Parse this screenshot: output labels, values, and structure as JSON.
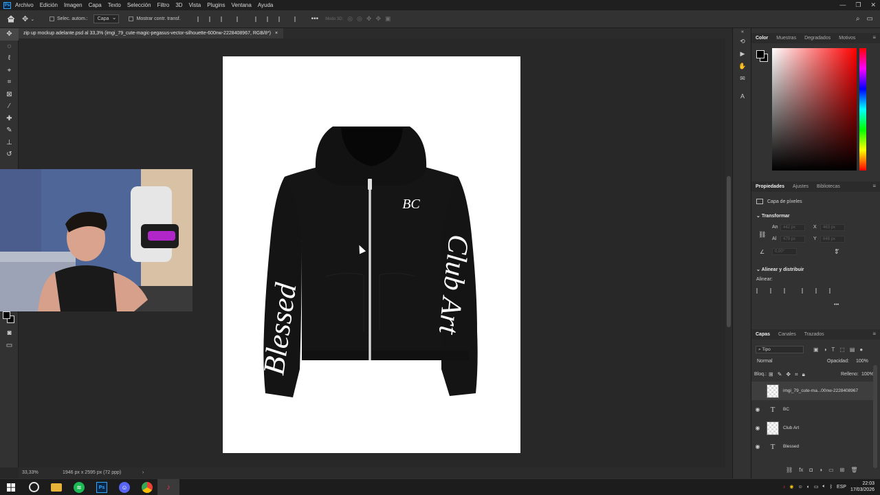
{
  "app": {
    "menu": [
      "Archivo",
      "Edición",
      "Imagen",
      "Capa",
      "Texto",
      "Selección",
      "Filtro",
      "3D",
      "Vista",
      "Plugins",
      "Ventana",
      "Ayuda"
    ]
  },
  "options_bar": {
    "auto_select_label": "Selec. autom.:",
    "auto_select_value": "Capa",
    "show_transform_label": "Mostrar contr. transf.",
    "mode_3d_label": "Modo 3D:"
  },
  "document": {
    "tab_title": "zip up mockup adelante.psd al 33,3% (imgi_79_cute-magic-pegasus-vector-silhouette-600nw-2228408967, RGB/8*)",
    "close_glyph": "×"
  },
  "artwork": {
    "logo_text": "BC",
    "left_sleeve_text": "Blessed",
    "right_sleeve_text": "Club Art"
  },
  "status": {
    "zoom": "33,33%",
    "doc_info": "1946 px x 2595 px (72 ppp)",
    "arrow": "›"
  },
  "color_panel": {
    "tabs": [
      "Color",
      "Muestras",
      "Degradados",
      "Motivos"
    ]
  },
  "properties_panel": {
    "tabs": [
      "Propiedades",
      "Ajustes",
      "Bibliotecas"
    ],
    "layer_type": "Capa de píxeles",
    "transform_title": "Transformar",
    "an_label": "An",
    "an_value": "442 px",
    "x_label": "X",
    "x_value": "463 px",
    "al_label": "Al",
    "al_value": "479 px",
    "y_label": "Y",
    "y_value": "646 px",
    "angle_value": "0,00°",
    "align_title": "Alinear y distribuir",
    "align_label": "Alinear:",
    "more": "•••"
  },
  "layers_panel": {
    "tabs": [
      "Capas",
      "Canales",
      "Trazados"
    ],
    "filter_label": "Tipo",
    "blend_mode": "Normal",
    "opacity_label": "Opacidad:",
    "opacity_value": "100%",
    "lock_label": "Bloq.:",
    "fill_label": "Relleno:",
    "fill_value": "100%",
    "layers": [
      {
        "name": "imgi_79_cute-ma...00nw-2228408967",
        "kind": "pixel",
        "visible": false,
        "selected": true
      },
      {
        "name": "BC",
        "kind": "text",
        "visible": true
      },
      {
        "name": "Club Art",
        "kind": "pixel",
        "visible": true
      },
      {
        "name": "Blessed",
        "kind": "text",
        "visible": true
      }
    ]
  },
  "taskbar": {
    "language": "ESP",
    "time": "22:03",
    "date": "17/03/2026"
  },
  "colors": {
    "accent": "#31a8ff",
    "hoodie": "#141414",
    "ui_dark": "#282828"
  }
}
